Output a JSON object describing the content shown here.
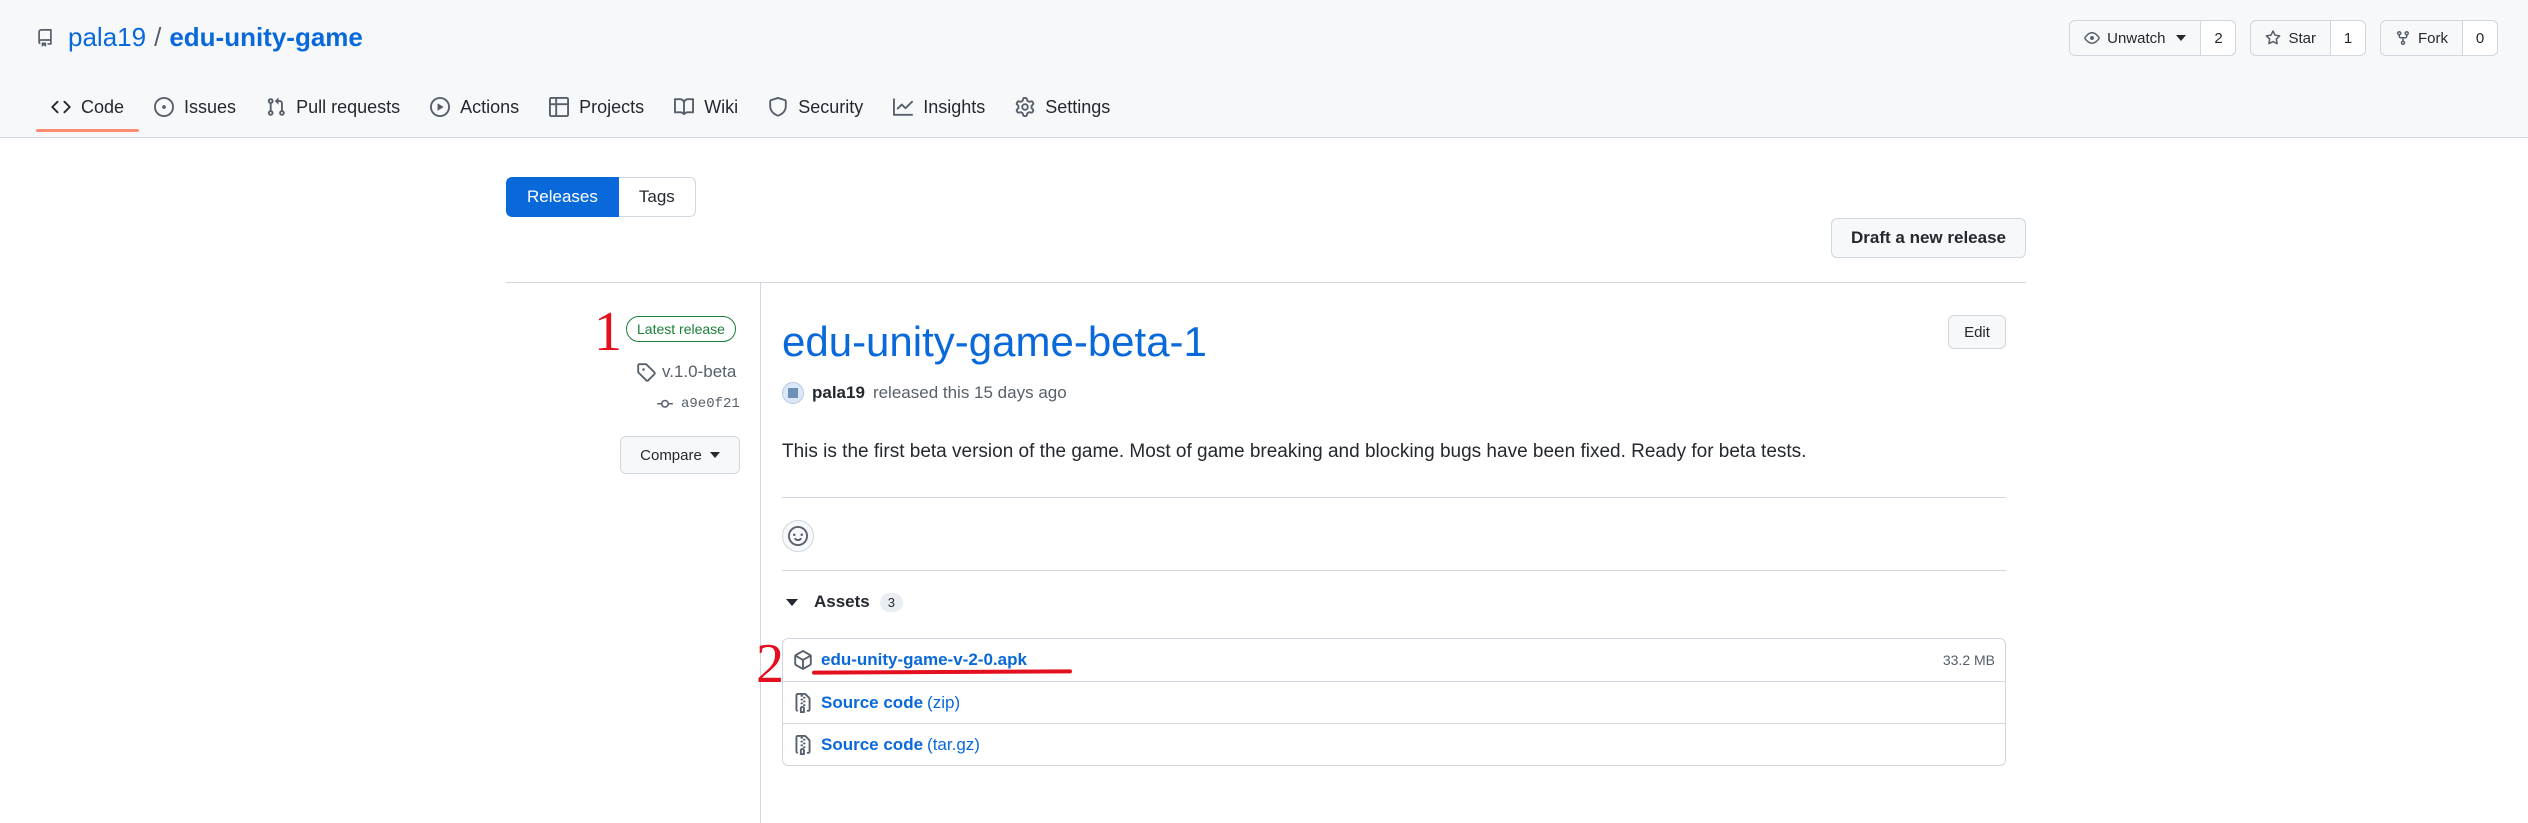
{
  "repo": {
    "owner": "pala19",
    "separator": "/",
    "name": "edu-unity-game"
  },
  "actions": {
    "watch": {
      "label": "Unwatch",
      "count": "2"
    },
    "star": {
      "label": "Star",
      "count": "1"
    },
    "fork": {
      "label": "Fork",
      "count": "0"
    }
  },
  "nav": {
    "tabs": [
      {
        "label": "Code",
        "icon": "code-icon"
      },
      {
        "label": "Issues",
        "icon": "issue-icon"
      },
      {
        "label": "Pull requests",
        "icon": "pull-request-icon"
      },
      {
        "label": "Actions",
        "icon": "play-icon"
      },
      {
        "label": "Projects",
        "icon": "table-icon"
      },
      {
        "label": "Wiki",
        "icon": "book-icon"
      },
      {
        "label": "Security",
        "icon": "shield-icon"
      },
      {
        "label": "Insights",
        "icon": "graph-icon"
      },
      {
        "label": "Settings",
        "icon": "gear-icon"
      }
    ]
  },
  "subnav": {
    "releases": "Releases",
    "tags": "Tags"
  },
  "draft_button": "Draft a new release",
  "annotations": {
    "one": "1",
    "two": "2"
  },
  "release": {
    "badge": "Latest release",
    "tag": "v.1.0-beta",
    "commit": "a9e0f21",
    "compare": "Compare",
    "title": "edu-unity-game-beta-1",
    "edit": "Edit",
    "author": "pala19",
    "released_text": "released this 15 days ago",
    "description": "This is the first beta version of the game. Most of game breaking and blocking bugs have been fixed. Ready for beta tests."
  },
  "assets": {
    "label": "Assets",
    "count": "3",
    "items": [
      {
        "name": "edu-unity-game-v-2-0.apk",
        "size": "33.2 MB"
      },
      {
        "name": "Source code",
        "suffix": "(zip)"
      },
      {
        "name": "Source code",
        "suffix": "(tar.gz)"
      }
    ]
  },
  "colors": {
    "accent": "#0969da",
    "active_underline": "#fd8c73",
    "annotation": "#e3101f",
    "latest_green": "#1a7f37"
  }
}
